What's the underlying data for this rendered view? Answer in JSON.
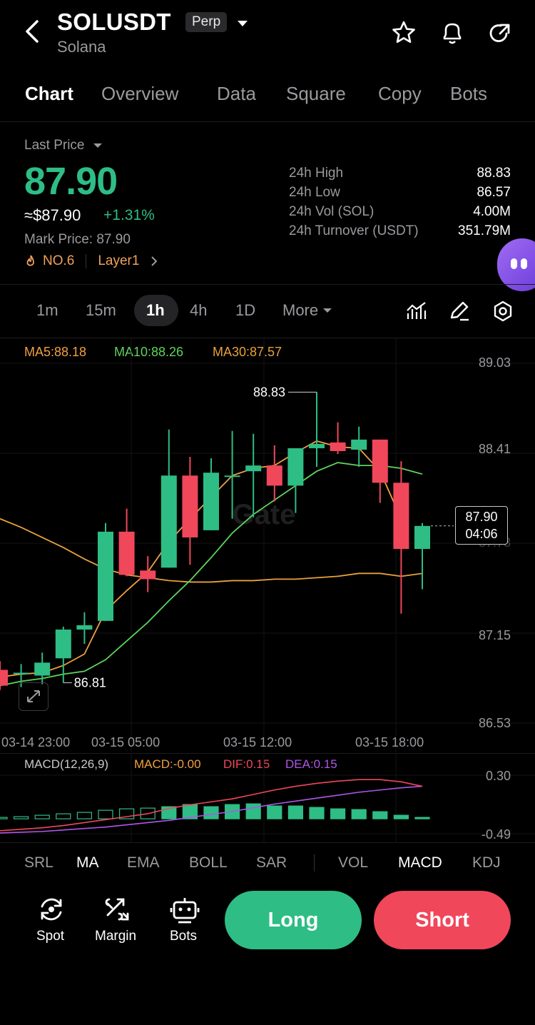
{
  "header": {
    "symbol": "SOLUSDT",
    "badge": "Perp",
    "name": "Solana"
  },
  "tabs": [
    "Chart",
    "Overview",
    "Data",
    "Square",
    "Copy",
    "Bots"
  ],
  "price": {
    "last_price_label": "Last Price",
    "last_price": "87.90",
    "usd_value": "≈$87.90",
    "change": "+1.31%",
    "mark_price": "Mark Price: 87.90",
    "rank": "NO.6",
    "tag": "Layer1"
  },
  "stats": [
    {
      "label": "24h  High",
      "value": "88.83"
    },
    {
      "label": "24h  Low",
      "value": "86.57"
    },
    {
      "label": "24h  Vol (SOL)",
      "value": "4.00M"
    },
    {
      "label": "24h  Turnover (USDT)",
      "value": "351.79M"
    }
  ],
  "timeframes": [
    "1m",
    "15m",
    "1h",
    "4h",
    "1D",
    "More"
  ],
  "indicators": {
    "ma5": "MA5:88.18",
    "ma10": "MA10:88.26",
    "ma30": "MA30:87.57",
    "macd_name": "MACD(12,26,9)",
    "macd": "MACD:-0.00",
    "dif": "DIF:0.15",
    "dea": "DEA:0.15"
  },
  "chart_labels": {
    "high_marker": "88.83",
    "low_marker": "86.81",
    "current_price": "87.90",
    "countdown": "04:06",
    "macd_top": "0.30",
    "macd_bottom": "-0.49",
    "watermark": "Gate"
  },
  "colors": {
    "up": "#2ebd85",
    "down": "#f0475b",
    "ma5": "#f0a040",
    "ma10": "#5fd35b",
    "ma30": "#e9a13b"
  },
  "chart_data": {
    "type": "candlestick",
    "y_ticks": [
      "89.03",
      "88.41",
      "87.78",
      "87.15",
      "86.53"
    ],
    "ylim": [
      86.53,
      89.03
    ],
    "x_ticks": [
      "03-14 23:00",
      "03-15 05:00",
      "03-15 12:00",
      "03-15 18:00"
    ],
    "candles": [
      {
        "o": 86.9,
        "h": 86.96,
        "l": 86.76,
        "c": 86.79
      },
      {
        "o": 86.88,
        "h": 86.94,
        "l": 86.78,
        "c": 86.88
      },
      {
        "o": 86.86,
        "h": 87.02,
        "l": 86.8,
        "c": 86.95
      },
      {
        "o": 86.98,
        "h": 87.2,
        "l": 86.81,
        "c": 87.18
      },
      {
        "o": 87.18,
        "h": 87.3,
        "l": 87.08,
        "c": 87.21
      },
      {
        "o": 87.24,
        "h": 87.92,
        "l": 87.24,
        "c": 87.86
      },
      {
        "o": 87.86,
        "h": 88.02,
        "l": 87.55,
        "c": 87.56
      },
      {
        "o": 87.59,
        "h": 87.69,
        "l": 87.44,
        "c": 87.53
      },
      {
        "o": 87.61,
        "h": 88.57,
        "l": 87.61,
        "c": 88.25
      },
      {
        "o": 88.25,
        "h": 88.38,
        "l": 87.63,
        "c": 87.82
      },
      {
        "o": 87.87,
        "h": 88.37,
        "l": 87.87,
        "c": 88.27
      },
      {
        "o": 88.25,
        "h": 88.56,
        "l": 87.95,
        "c": 88.25
      },
      {
        "o": 88.28,
        "h": 88.54,
        "l": 87.96,
        "c": 88.32
      },
      {
        "o": 88.32,
        "h": 88.46,
        "l": 88.07,
        "c": 88.18
      },
      {
        "o": 88.18,
        "h": 88.44,
        "l": 87.99,
        "c": 88.44
      },
      {
        "o": 88.44,
        "h": 88.83,
        "l": 88.31,
        "c": 88.47
      },
      {
        "o": 88.48,
        "h": 88.62,
        "l": 88.4,
        "c": 88.42
      },
      {
        "o": 88.43,
        "h": 88.59,
        "l": 88.31,
        "c": 88.5
      },
      {
        "o": 88.5,
        "h": 88.5,
        "l": 88.06,
        "c": 88.2
      },
      {
        "o": 88.2,
        "h": 88.35,
        "l": 87.29,
        "c": 87.74
      },
      {
        "o": 87.74,
        "h": 87.92,
        "l": 87.46,
        "c": 87.9
      }
    ],
    "ma5": [
      86.85,
      86.87,
      86.88,
      86.93,
      87.01,
      87.31,
      87.45,
      87.58,
      87.79,
      87.95,
      88.1,
      88.25,
      88.3,
      88.32,
      88.41,
      88.49,
      88.45,
      88.44,
      88.28,
      87.95
    ],
    "ma10": [
      86.79,
      86.82,
      86.84,
      86.87,
      86.89,
      86.97,
      87.1,
      87.23,
      87.38,
      87.52,
      87.68,
      87.85,
      87.98,
      88.08,
      88.18,
      88.28,
      88.34,
      88.32,
      88.32,
      88.3,
      88.26
    ],
    "ma30": [
      87.95,
      87.89,
      87.82,
      87.75,
      87.67,
      87.6,
      87.56,
      87.54,
      87.52,
      87.51,
      87.51,
      87.52,
      87.52,
      87.53,
      87.53,
      87.54,
      87.55,
      87.57,
      87.57,
      87.55,
      87.57
    ],
    "macd": {
      "ylim": [
        -0.49,
        0.3
      ],
      "hist": [
        0.02,
        0.03,
        0.05,
        0.07,
        0.09,
        0.12,
        0.14,
        0.15,
        0.17,
        0.2,
        0.17,
        0.2,
        0.21,
        0.18,
        0.18,
        0.16,
        0.14,
        0.13,
        0.1,
        0.05,
        0.02
      ],
      "dif": [
        -0.45,
        -0.43,
        -0.41,
        -0.38,
        -0.34,
        -0.3,
        -0.26,
        -0.22,
        -0.15,
        -0.1,
        -0.06,
        -0.02,
        0.04,
        0.1,
        0.15,
        0.19,
        0.22,
        0.24,
        0.24,
        0.21,
        0.15
      ],
      "dea": [
        -0.48,
        -0.47,
        -0.46,
        -0.44,
        -0.42,
        -0.4,
        -0.37,
        -0.34,
        -0.31,
        -0.27,
        -0.23,
        -0.19,
        -0.14,
        -0.09,
        -0.05,
        -0.01,
        0.03,
        0.07,
        0.1,
        0.13,
        0.15
      ]
    }
  },
  "indicator_tabs": [
    "SRL",
    "MA",
    "EMA",
    "BOLL",
    "SAR",
    "VOL",
    "MACD",
    "KDJ"
  ],
  "bottom": {
    "spot": "Spot",
    "margin": "Margin",
    "bots": "Bots",
    "long": "Long",
    "short": "Short"
  }
}
